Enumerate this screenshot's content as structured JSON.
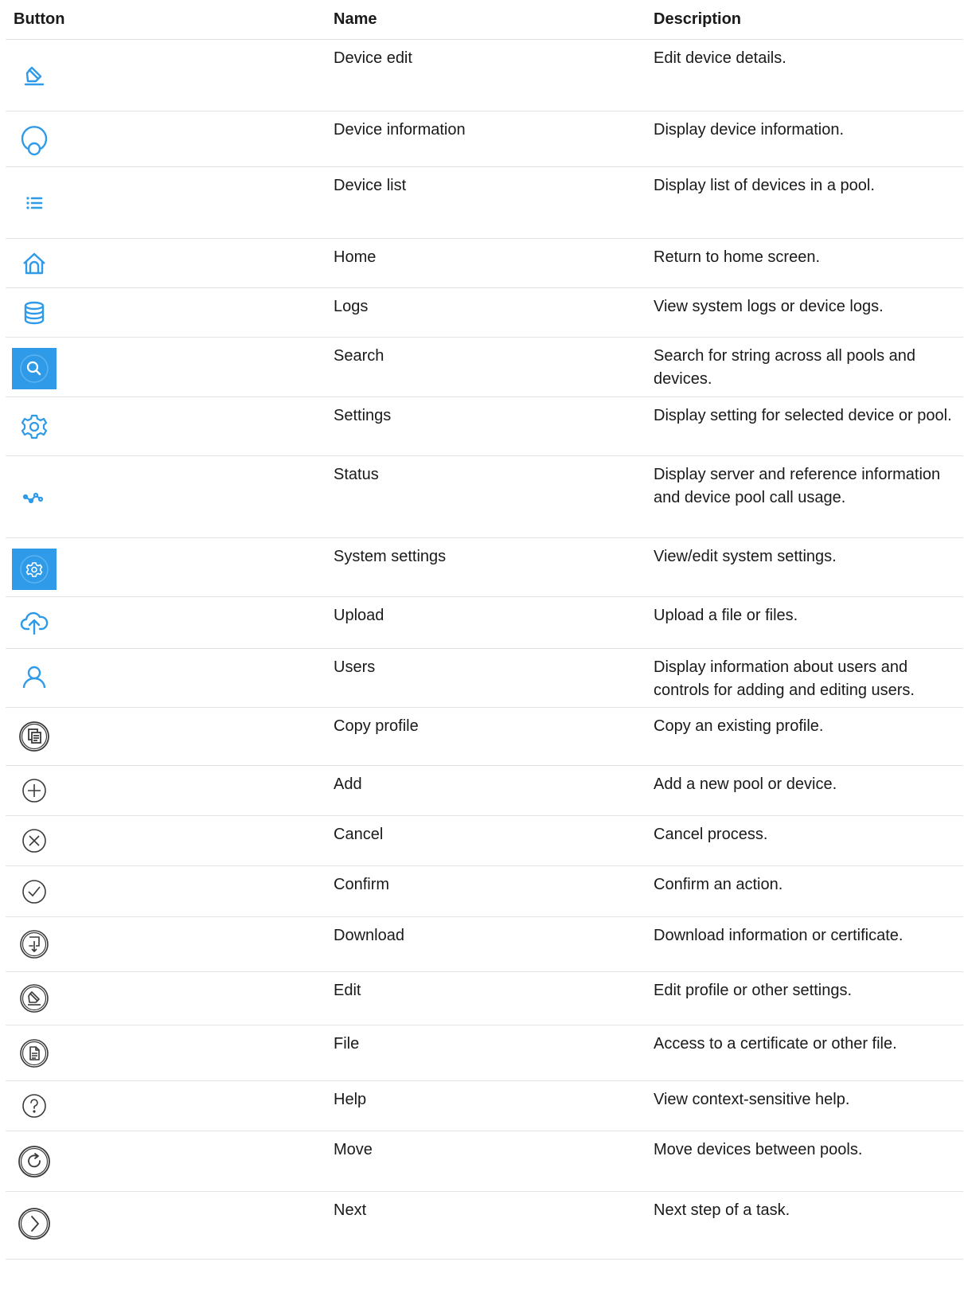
{
  "headers": {
    "button": "Button",
    "name": "Name",
    "description": "Description"
  },
  "accent_color": "#2f9be8",
  "icon_dark_color": "#3a3a3a",
  "rows": [
    {
      "icon": "pencil-icon",
      "name": "Device edit",
      "description": "Edit device details."
    },
    {
      "icon": "device-info-icon",
      "name": "Device information",
      "description": "Display device information."
    },
    {
      "icon": "list-icon",
      "name": "Device list",
      "description": "Display list of devices in a pool."
    },
    {
      "icon": "home-icon",
      "name": "Home",
      "description": "Return to home screen."
    },
    {
      "icon": "database-icon",
      "name": "Logs",
      "description": "View system logs or device logs."
    },
    {
      "icon": "search-icon",
      "name": "Search",
      "description": "Search for string across all pools and devices."
    },
    {
      "icon": "gear-icon",
      "name": "Settings",
      "description": "Display setting for selected device or pool."
    },
    {
      "icon": "status-graph-icon",
      "name": "Status",
      "description": "Display server and reference information and device pool call usage."
    },
    {
      "icon": "system-gear-icon",
      "name": "System settings",
      "description": "View/edit system settings."
    },
    {
      "icon": "cloud-upload-icon",
      "name": "Upload",
      "description": "Upload a file or files."
    },
    {
      "icon": "user-icon",
      "name": "Users",
      "description": "Display information about users and controls for adding and editing users."
    },
    {
      "icon": "copy-profile-icon",
      "name": "Copy profile",
      "description": "Copy an existing profile."
    },
    {
      "icon": "add-circle-icon",
      "name": "Add",
      "description": "Add a new pool or device."
    },
    {
      "icon": "cancel-circle-icon",
      "name": "Cancel",
      "description": "Cancel process."
    },
    {
      "icon": "confirm-circle-icon",
      "name": "Confirm",
      "description": "Confirm an action."
    },
    {
      "icon": "download-circle-icon",
      "name": "Download",
      "description": "Download information or certificate."
    },
    {
      "icon": "edit-circle-icon",
      "name": "Edit",
      "description": "Edit profile or other settings."
    },
    {
      "icon": "file-circle-icon",
      "name": "File",
      "description": "Access to a certificate or other file."
    },
    {
      "icon": "help-circle-icon",
      "name": "Help",
      "description": "View context-sensitive help."
    },
    {
      "icon": "move-circle-icon",
      "name": "Move",
      "description": "Move devices between pools."
    },
    {
      "icon": "next-circle-icon",
      "name": "Next",
      "description": "Next step of a task."
    }
  ]
}
